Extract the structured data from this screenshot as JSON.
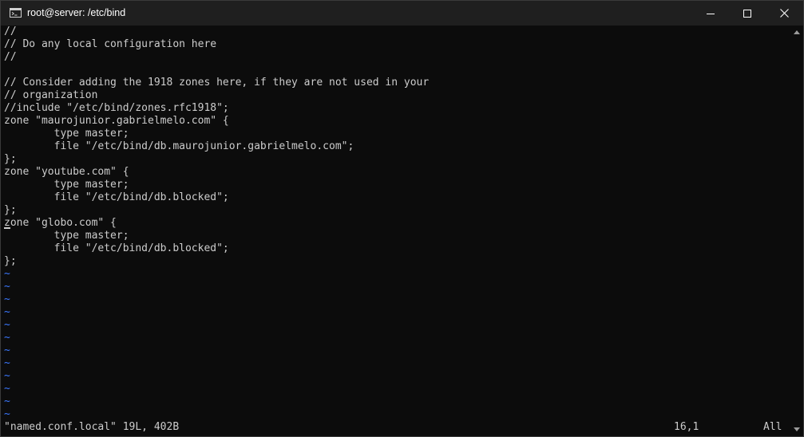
{
  "window": {
    "title": "root@server: /etc/bind",
    "app_icon": "console-icon",
    "buttons": {
      "minimize_icon": "minimize-icon",
      "maximize_icon": "maximize-icon",
      "close_icon": "close-icon"
    }
  },
  "editor": {
    "lines": [
      "//",
      "// Do any local configuration here",
      "//",
      "",
      "// Consider adding the 1918 zones here, if they are not used in your",
      "// organization",
      "//include \"/etc/bind/zones.rfc1918\";",
      "zone \"maurojunior.gabrielmelo.com\" {",
      "        type master;",
      "        file \"/etc/bind/db.maurojunior.gabrielmelo.com\";",
      "};",
      "zone \"youtube.com\" {",
      "        type master;",
      "        file \"/etc/bind/db.blocked\";",
      "};",
      "zone \"globo.com\" {",
      "        type master;",
      "        file \"/etc/bind/db.blocked\";",
      "};"
    ],
    "empty_line_marker": "~",
    "empty_line_count": 12,
    "cursor_position": "16,1"
  },
  "status_bar": {
    "file_info": "\"named.conf.local\" 19L, 402B",
    "position": "16,1",
    "scroll": "All"
  },
  "colors": {
    "background": "#0c0c0c",
    "text": "#cccccc",
    "tilde": "#3b78ff",
    "titlebar": "#1f1f1f"
  }
}
